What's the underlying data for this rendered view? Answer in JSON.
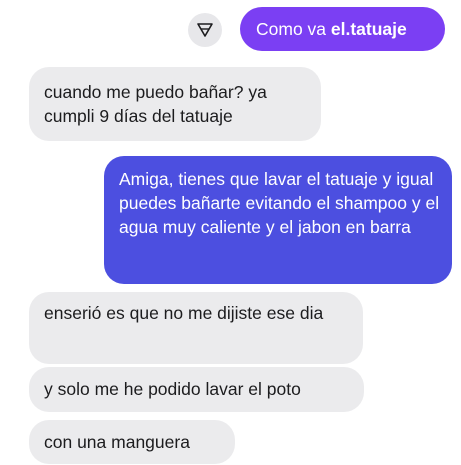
{
  "colors": {
    "incoming_bubble": "#ebebed",
    "outgoing_bubble_top": "#7b3ff3",
    "outgoing_bubble_main": "#4c4fe0",
    "reaction_button": "#e7e7ea"
  },
  "reply_button": {
    "icon": "triangle-down-icon"
  },
  "messages": [
    {
      "direction": "outgoing",
      "text": "Como va ",
      "emphasis": "el.tatuaje"
    },
    {
      "direction": "incoming",
      "text": "cuando me puedo bañar? ya cumpli 9 días del tatuaje"
    },
    {
      "direction": "outgoing",
      "text": "Amiga, tienes que lavar el tatuaje y igual puedes bañarte evitando el shampoo y el agua muy caliente y el jabon en barra"
    },
    {
      "direction": "incoming",
      "text": "enserió es que no me dijiste ese dia"
    },
    {
      "direction": "incoming",
      "text": "y solo me he podido lavar el poto"
    },
    {
      "direction": "incoming",
      "text": "con una manguera"
    }
  ]
}
